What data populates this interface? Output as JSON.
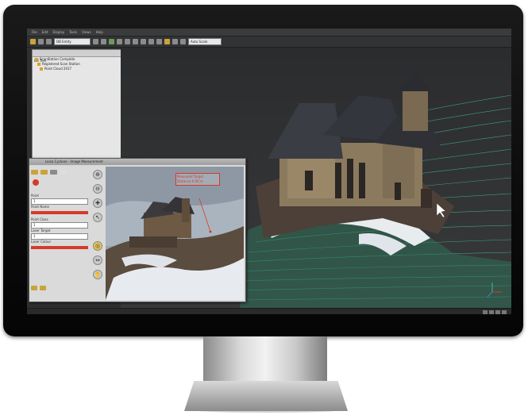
{
  "menubar": {
    "items": [
      "File",
      "Edit",
      "Display",
      "Tools",
      "Views",
      "Help"
    ]
  },
  "toolbar": {
    "view_dropdown": "DB Entity",
    "scale_dropdown": "Auto Scale"
  },
  "db_tree": {
    "title": "DB Tree",
    "items": [
      "ScanStation Complete",
      "Registered Scan Station",
      "Point Cloud 2017"
    ]
  },
  "dialog": {
    "title": "Leica Cyclone - Image Measurement",
    "fields": [
      {
        "label": "Point",
        "value": "1"
      },
      {
        "label": "Point Name",
        "value": ""
      },
      {
        "label": "Point Class",
        "value": "1"
      },
      {
        "label": "Laser Target",
        "value": "1"
      },
      {
        "label": "Laser Colour",
        "value": ""
      }
    ],
    "annotation": [
      "Measured Target",
      "Distance 0.00 m"
    ]
  },
  "colors": {
    "accent_red": "#d63a2c",
    "contour_green": "#3fbf8a"
  }
}
